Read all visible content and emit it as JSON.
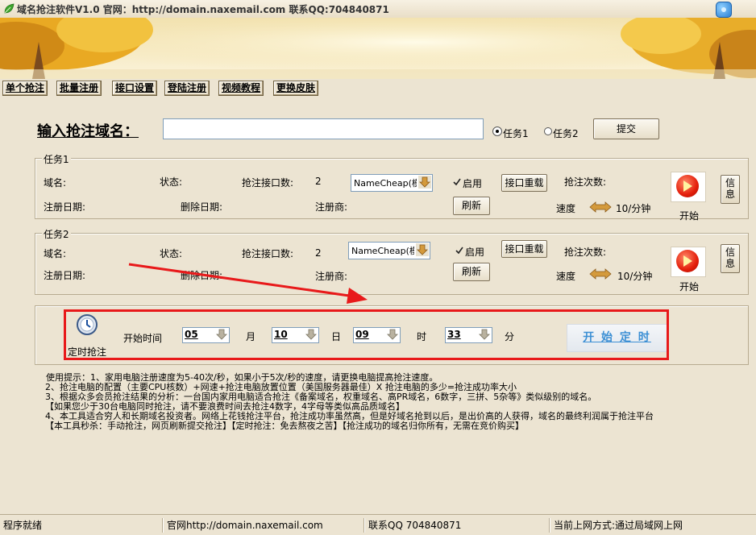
{
  "window": {
    "title": "域名抢注软件V1.0  官网：http://domain.naxemail.com  联系QQ:704840871"
  },
  "tabs": [
    "单个抢注",
    "批量注册",
    "接口设置",
    "登陆注册",
    "视频教程",
    "更换皮肤"
  ],
  "input_section": {
    "label": "输入抢注域名：",
    "value": "",
    "radio_task1": "任务1",
    "radio_task2": "任务2",
    "selected": "任务1",
    "submit": "提交"
  },
  "tasks": [
    {
      "group_title": "任务1",
      "domain_label": "域名:",
      "status_label": "状态:",
      "api_count_label": "抢注接口数:",
      "api_count": "2",
      "provider": "NameCheap(模拟",
      "enable_label": "启用",
      "enabled": true,
      "reload_btn": "接口重载",
      "attempts_label": "抢注次数:",
      "reg_date_label": "注册日期:",
      "del_date_label": "删除日期:",
      "registrar_label": "注册商:",
      "refresh_btn": "刷新",
      "speed_label": "速度",
      "speed_value": "10/分钟",
      "start_label": "开始",
      "info_btn": "信息"
    },
    {
      "group_title": "任务2",
      "domain_label": "域名:",
      "status_label": "状态:",
      "api_count_label": "抢注接口数:",
      "api_count": "2",
      "provider": "NameCheap(模拟",
      "enable_label": "启用",
      "enabled": true,
      "reload_btn": "接口重载",
      "attempts_label": "抢注次数:",
      "reg_date_label": "注册日期:",
      "del_date_label": "删除日期:",
      "registrar_label": "注册商:",
      "refresh_btn": "刷新",
      "speed_label": "速度",
      "speed_value": "10/分钟",
      "start_label": "开始",
      "info_btn": "信息"
    }
  ],
  "timer": {
    "icon_label": "定时抢注",
    "start_time_label": "开始时间",
    "month": "05",
    "month_unit": "月",
    "day": "10",
    "day_unit": "日",
    "hour": "09",
    "hour_unit": "时",
    "minute": "33",
    "minute_unit": "分",
    "start_btn": "开 始 定 时"
  },
  "tips": [
    "使用提示：1、家用电脑注册速度为5-40次/秒，如果小于5次/秒的速度，请更换电脑提高抢注速度。",
    "2、抢注电脑的配置（主要CPU核数）+网速+抢注电脑放置位置（美国服务器最佳）X 抢注电脑的多少=抢注成功率大小",
    "3、根据众多会员抢注结果的分析：一台国内家用电脑适合抢注《备案域名，权重域名、高PR域名，6数字，三拼、5杂等》类似级别的域名。",
    "【如果您少于30台电脑同时抢注，请不要浪费时间去抢注4数字，4字母等类似高品质域名】",
    "4、本工具适合穷人和长期域名投资者。网络上花钱抢注平台，抢注成功率虽然高，但是好域名抢到以后，是出价高的人获得，域名的最终利润属于抢注平台",
    "【本工具秒杀：手动抢注，网页刷新提交抢注】【定时抢注：免去熬夜之苦】【抢注成功的域名归你所有，无需在竞价购买】"
  ],
  "status": {
    "ready": "程序就绪",
    "site": "官网http://domain.naxemail.com",
    "qq": "联系QQ 704840871",
    "network": "当前上网方式:通过局域网上网"
  },
  "colors": {
    "background": "#ece4d2",
    "highlight_border": "#e8191a",
    "annotation_arrow": "#e8191a",
    "timer_button_text": "#3c8fd4"
  }
}
